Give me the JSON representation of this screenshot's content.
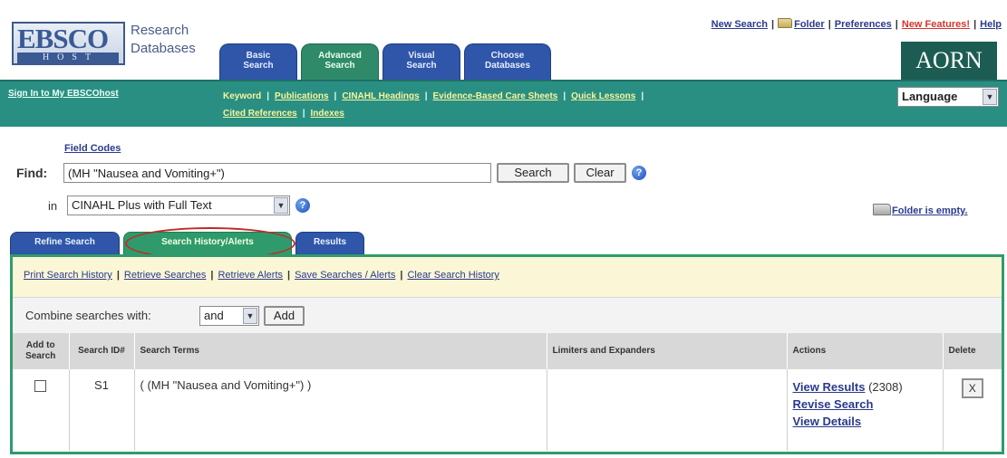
{
  "header": {
    "logo_top": "EBSCO",
    "logo_bottom": "HOST",
    "brand_line1": "Research",
    "brand_line2": "Databases",
    "tabs": [
      {
        "line1": "Basic",
        "line2": "Search"
      },
      {
        "line1": "Advanced",
        "line2": "Search"
      },
      {
        "line1": "Visual",
        "line2": "Search"
      },
      {
        "line1": "Choose",
        "line2": "Databases"
      }
    ],
    "toplinks": {
      "new_search": "New Search",
      "folder": "Folder",
      "preferences": "Preferences",
      "new_features": "New Features!",
      "help": "Help"
    },
    "partner_logo": "AORN"
  },
  "navbar": {
    "signin": "Sign In to My EBSCOhost",
    "links": [
      "Keyword",
      "Publications",
      "CINAHL Headings",
      "Evidence-Based Care Sheets",
      "Quick Lessons",
      "Cited References",
      "Indexes"
    ],
    "language": "Language"
  },
  "find": {
    "field_codes": "Field Codes",
    "label": "Find:",
    "query": "(MH \"Nausea and Vomiting+\")",
    "search_button": "Search",
    "clear_button": "Clear",
    "in_label": "in",
    "database": "CINAHL Plus with Full Text",
    "folder_status": "Folder is empty."
  },
  "lower_tabs": [
    "Refine Search",
    "Search History/Alerts",
    "Results"
  ],
  "panel": {
    "links": [
      "Print Search History",
      "Retrieve Searches",
      "Retrieve Alerts",
      "Save Searches / Alerts",
      "Clear Search History"
    ],
    "combine_label": "Combine searches with:",
    "combine_value": "and",
    "add_button": "Add"
  },
  "table": {
    "headers": {
      "add": "Add to Search",
      "id": "Search ID#",
      "terms": "Search Terms",
      "limits": "Limiters and Expanders",
      "actions": "Actions",
      "delete": "Delete"
    },
    "rows": [
      {
        "id": "S1",
        "terms": "( (MH \"Nausea and Vomiting+\") )",
        "limits": "",
        "view_results": "View Results",
        "count": "(2308)",
        "revise": "Revise Search",
        "details": "View Details",
        "delete": "X"
      }
    ]
  }
}
